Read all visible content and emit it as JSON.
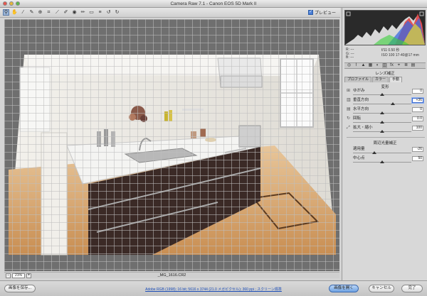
{
  "window": {
    "title": "Camera Raw 7.1 - Canon EOS 5D Mark II"
  },
  "toolbar": {
    "tools": [
      "zoom-tool-icon",
      "hand-tool-icon",
      "white-balance-tool-icon",
      "color-sampler-icon",
      "targeted-adjustment-icon",
      "crop-tool-icon",
      "straighten-tool-icon",
      "spot-removal-icon",
      "red-eye-icon",
      "adjustment-brush-icon",
      "graduated-filter-icon",
      "preferences-icon",
      "rotate-ccw-icon",
      "rotate-cw-icon"
    ],
    "preview_label": "プレビュー",
    "preview_checked": true
  },
  "canvas": {
    "zoom_value": "21%",
    "zoom_minus": "-",
    "zoom_plus": "+",
    "filename": "_MG_1616.CR2"
  },
  "meta": {
    "r_label": "R:",
    "g_label": "G:",
    "b_label": "B:",
    "r_value": "---",
    "g_value": "---",
    "b_value": "---",
    "aperture_shutter": "f/11   0.50 秒",
    "iso_lens": "ISO 100   17-40@17 mm"
  },
  "panel": {
    "section_title": "レンズ補正",
    "tabs": [
      "プロファイル",
      "カラー",
      "手動"
    ],
    "active_tab": 2,
    "transform_title": "変形",
    "sliders": [
      {
        "icon": "distortion-icon",
        "label": "ゆがみ",
        "value": "0",
        "pos": 0.5,
        "selected": false
      },
      {
        "icon": "vertical-icon",
        "label": "垂直方向",
        "value": "+36",
        "pos": 0.68,
        "selected": true
      },
      {
        "icon": "horizontal-icon",
        "label": "水平方向",
        "value": "0",
        "pos": 0.5,
        "selected": false
      },
      {
        "icon": "rotate-icon",
        "label": "回転",
        "value": "0.0",
        "pos": 0.5,
        "selected": false
      },
      {
        "icon": "scale-icon",
        "label": "拡大・縮小",
        "value": "100",
        "pos": 0.5,
        "selected": false
      }
    ],
    "vignette_title": "周辺光量補正",
    "vignette_sliders": [
      {
        "label": "適用量",
        "value": "-26",
        "pos": 0.37
      },
      {
        "label": "中心点",
        "value": "50",
        "pos": 0.5
      }
    ]
  },
  "footer": {
    "save_label": "画像を保存...",
    "info_link": "Adobe RGB (1998); 16 bit; 5616 x 3744 (21.0 メガピクセル); 360 ppi ; スクリーン標準",
    "open_label": "画像を開く",
    "cancel_label": "キャンセル",
    "done_label": "完了"
  }
}
